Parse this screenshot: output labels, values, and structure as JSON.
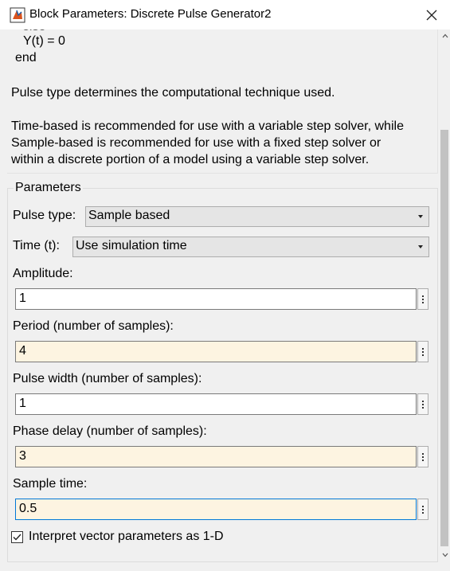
{
  "window": {
    "title": "Block Parameters: Discrete Pulse Generator2",
    "icon": "simulink-block-icon",
    "close_icon": "close-icon"
  },
  "description": {
    "code_lines": [
      "Y(t) = 0",
      "end"
    ],
    "paragraph1": "Pulse type determines the computational technique used.",
    "paragraph2_lines": [
      "Time-based is recommended for use with a variable step solver, while",
      "Sample-based is recommended for use with a fixed step solver or",
      "within a discrete portion of a model using a variable step solver."
    ]
  },
  "parameters": {
    "group_title": "Parameters",
    "pulse_type": {
      "label": "Pulse type:",
      "value": "Sample based"
    },
    "time": {
      "label": "Time (t):",
      "value": "Use simulation time"
    },
    "amplitude": {
      "label": "Amplitude:",
      "value": "1"
    },
    "period": {
      "label": "Period (number of samples):",
      "value": "4"
    },
    "pulse_width": {
      "label": "Pulse width (number of samples):",
      "value": "1"
    },
    "phase_delay": {
      "label": "Phase delay (number of samples):",
      "value": "3"
    },
    "sample_time": {
      "label": "Sample time:",
      "value": "0.5"
    },
    "interpret_vector": {
      "label": "Interpret vector parameters as 1-D",
      "checked": true
    }
  },
  "colors": {
    "cream_field": "#fdf4e1",
    "focus_border": "#0078d7",
    "background": "#f0f0f0"
  }
}
